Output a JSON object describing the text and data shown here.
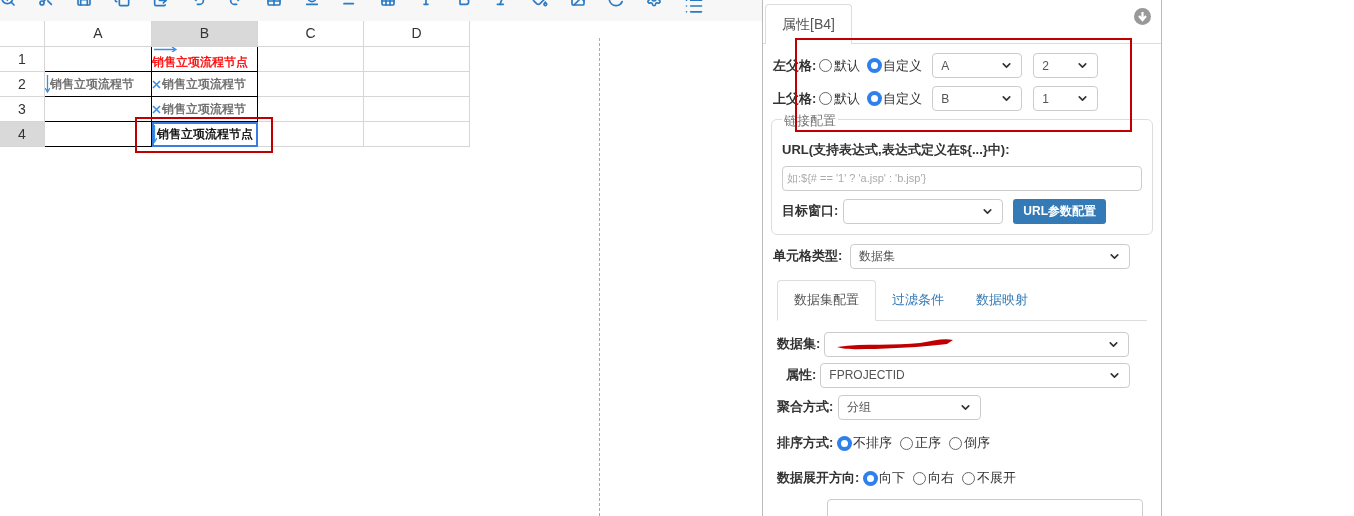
{
  "sheet": {
    "columns": [
      {
        "label": "A",
        "selected": false
      },
      {
        "label": "B",
        "selected": true
      },
      {
        "label": "C",
        "selected": false
      },
      {
        "label": "D",
        "selected": false
      }
    ],
    "rows": [
      {
        "label": "1",
        "selected": false,
        "cells": [
          {
            "text": "",
            "kind": "none",
            "selected": false
          },
          {
            "text": "销售立项流程节点",
            "kind": "right",
            "color": "#ff0000",
            "selected": false
          },
          {
            "text": "",
            "kind": "none",
            "selected": false
          },
          {
            "text": "",
            "kind": "none",
            "selected": false
          }
        ]
      },
      {
        "label": "2",
        "selected": false,
        "cells": [
          {
            "text": "销售立项流程节",
            "kind": "down",
            "color": "#666666",
            "selected": false
          },
          {
            "text": "销售立项流程节",
            "kind": "cross",
            "color": "#666666",
            "selected": false
          },
          {
            "text": "",
            "kind": "none",
            "selected": false
          },
          {
            "text": "",
            "kind": "none",
            "selected": false
          }
        ]
      },
      {
        "label": "3",
        "selected": false,
        "cells": [
          {
            "text": "",
            "kind": "none",
            "selected": false
          },
          {
            "text": "销售立项流程节",
            "kind": "cross",
            "color": "#666666",
            "selected": false
          },
          {
            "text": "",
            "kind": "none",
            "selected": false
          },
          {
            "text": "",
            "kind": "none",
            "selected": false
          }
        ]
      },
      {
        "label": "4",
        "selected": true,
        "cells": [
          {
            "text": "",
            "kind": "none",
            "selected": false
          },
          {
            "text": "销售立项流程节点",
            "kind": "down",
            "selected": true
          },
          {
            "text": "",
            "kind": "none",
            "selected": false
          },
          {
            "text": "",
            "kind": "none",
            "selected": false
          }
        ]
      }
    ]
  },
  "panel": {
    "tab": "属性[B4]",
    "parents": [
      {
        "label": "左父格:",
        "options": [
          {
            "label": "默认",
            "selected": false
          },
          {
            "label": "自定义",
            "selected": true
          }
        ],
        "column": "A",
        "row": "2"
      },
      {
        "label": "上父格:",
        "options": [
          {
            "label": "默认",
            "selected": false
          },
          {
            "label": "自定义",
            "selected": true
          }
        ],
        "column": "B",
        "row": "1"
      }
    ],
    "link": {
      "legend": "链接配置",
      "url_label": "URL(支持表达式,表达式定义在${...}中):",
      "url_placeholder": "如:${# == '1' ? 'a.jsp' : 'b.jsp'}",
      "target_label": "目标窗口:",
      "button": "URL参数配置"
    },
    "cell_type": {
      "label": "单元格类型:",
      "value": "数据集"
    },
    "tabs": [
      {
        "label": "数据集配置",
        "selected": true
      },
      {
        "label": "过滤条件",
        "selected": false
      },
      {
        "label": "数据映射",
        "selected": false
      }
    ],
    "dataset": {
      "label": "数据集:",
      "redacted": true
    },
    "attribute": {
      "label": "属性:",
      "value": "FPROJECTID"
    },
    "aggregate": {
      "label": "聚合方式:",
      "value": "分组"
    },
    "sort": {
      "label": "排序方式:",
      "options": [
        {
          "label": "不排序",
          "selected": true
        },
        {
          "label": "正序",
          "selected": false
        },
        {
          "label": "倒序",
          "selected": false
        }
      ]
    },
    "expand": {
      "label": "数据展开方向:",
      "options": [
        {
          "label": "向下",
          "selected": true
        },
        {
          "label": "向右",
          "selected": false
        },
        {
          "label": "不展开",
          "selected": false
        }
      ]
    }
  }
}
